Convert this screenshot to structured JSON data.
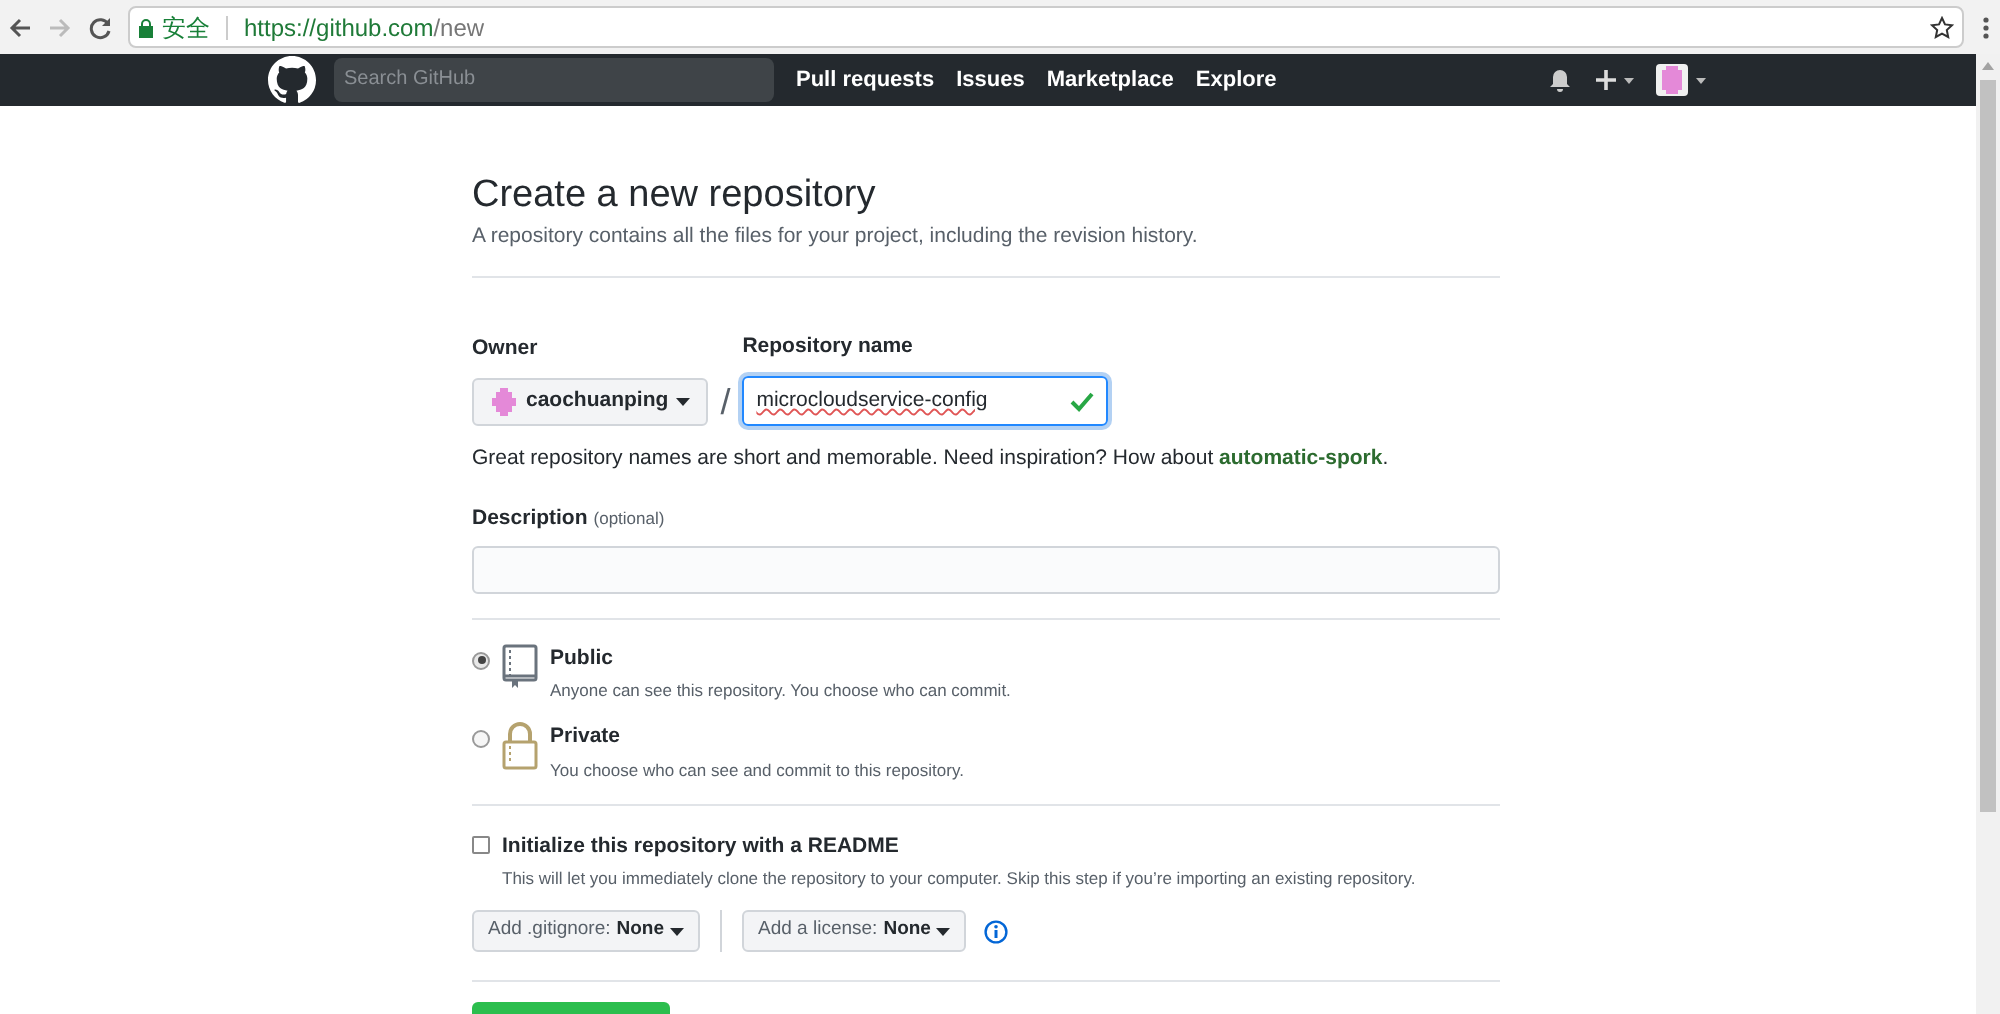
{
  "browser": {
    "security_label": "安全",
    "url_host": "https://github.com",
    "url_path": "/new"
  },
  "nav": {
    "search_placeholder": "Search GitHub",
    "links": [
      "Pull requests",
      "Issues",
      "Marketplace",
      "Explore"
    ]
  },
  "page": {
    "title": "Create a new repository",
    "subtitle": "A repository contains all the files for your project, including the revision history.",
    "owner_label": "Owner",
    "owner": "caochuanping",
    "separator": "/",
    "repo_label": "Repository name",
    "repo_name": "microcloudservice-config",
    "name_valid": true,
    "hint": "Great repository names are short and memorable. Need inspiration? How about **automatic-spork**.",
    "description_label": "Description",
    "description_note": "(optional)",
    "visibility": [
      {
        "kind": "public",
        "title": "Public",
        "description": "Anyone can see this repository. You choose who can commit.",
        "selected": true
      },
      {
        "kind": "private",
        "title": "Private",
        "description": "You choose who can see and commit to this repository.",
        "selected": false
      }
    ],
    "readme": {
      "label": "Initialize this repository with a README",
      "description": "This will let you immediately clone the repository to your computer. Skip this step if you’re importing an existing repository.",
      "checked": false
    },
    "dropdowns": [
      {
        "label": "Add .gitignore:",
        "value": "None"
      },
      {
        "label": "Add a license:",
        "value": "None"
      }
    ]
  }
}
